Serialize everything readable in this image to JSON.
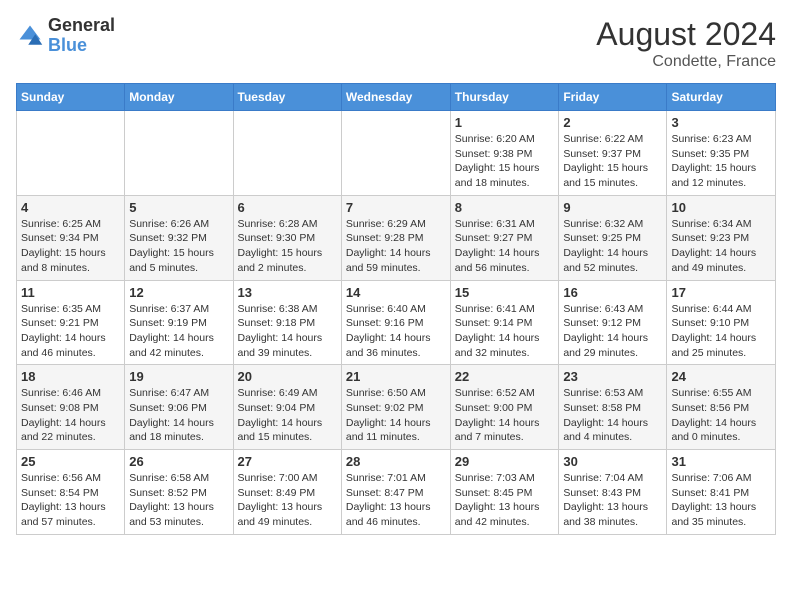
{
  "logo": {
    "general": "General",
    "blue": "Blue"
  },
  "header": {
    "month_year": "August 2024",
    "location": "Condette, France"
  },
  "weekdays": [
    "Sunday",
    "Monday",
    "Tuesday",
    "Wednesday",
    "Thursday",
    "Friday",
    "Saturday"
  ],
  "weeks": [
    [
      {
        "day": "",
        "info": ""
      },
      {
        "day": "",
        "info": ""
      },
      {
        "day": "",
        "info": ""
      },
      {
        "day": "",
        "info": ""
      },
      {
        "day": "1",
        "info": "Sunrise: 6:20 AM\nSunset: 9:38 PM\nDaylight: 15 hours and 18 minutes."
      },
      {
        "day": "2",
        "info": "Sunrise: 6:22 AM\nSunset: 9:37 PM\nDaylight: 15 hours and 15 minutes."
      },
      {
        "day": "3",
        "info": "Sunrise: 6:23 AM\nSunset: 9:35 PM\nDaylight: 15 hours and 12 minutes."
      }
    ],
    [
      {
        "day": "4",
        "info": "Sunrise: 6:25 AM\nSunset: 9:34 PM\nDaylight: 15 hours and 8 minutes."
      },
      {
        "day": "5",
        "info": "Sunrise: 6:26 AM\nSunset: 9:32 PM\nDaylight: 15 hours and 5 minutes."
      },
      {
        "day": "6",
        "info": "Sunrise: 6:28 AM\nSunset: 9:30 PM\nDaylight: 15 hours and 2 minutes."
      },
      {
        "day": "7",
        "info": "Sunrise: 6:29 AM\nSunset: 9:28 PM\nDaylight: 14 hours and 59 minutes."
      },
      {
        "day": "8",
        "info": "Sunrise: 6:31 AM\nSunset: 9:27 PM\nDaylight: 14 hours and 56 minutes."
      },
      {
        "day": "9",
        "info": "Sunrise: 6:32 AM\nSunset: 9:25 PM\nDaylight: 14 hours and 52 minutes."
      },
      {
        "day": "10",
        "info": "Sunrise: 6:34 AM\nSunset: 9:23 PM\nDaylight: 14 hours and 49 minutes."
      }
    ],
    [
      {
        "day": "11",
        "info": "Sunrise: 6:35 AM\nSunset: 9:21 PM\nDaylight: 14 hours and 46 minutes."
      },
      {
        "day": "12",
        "info": "Sunrise: 6:37 AM\nSunset: 9:19 PM\nDaylight: 14 hours and 42 minutes."
      },
      {
        "day": "13",
        "info": "Sunrise: 6:38 AM\nSunset: 9:18 PM\nDaylight: 14 hours and 39 minutes."
      },
      {
        "day": "14",
        "info": "Sunrise: 6:40 AM\nSunset: 9:16 PM\nDaylight: 14 hours and 36 minutes."
      },
      {
        "day": "15",
        "info": "Sunrise: 6:41 AM\nSunset: 9:14 PM\nDaylight: 14 hours and 32 minutes."
      },
      {
        "day": "16",
        "info": "Sunrise: 6:43 AM\nSunset: 9:12 PM\nDaylight: 14 hours and 29 minutes."
      },
      {
        "day": "17",
        "info": "Sunrise: 6:44 AM\nSunset: 9:10 PM\nDaylight: 14 hours and 25 minutes."
      }
    ],
    [
      {
        "day": "18",
        "info": "Sunrise: 6:46 AM\nSunset: 9:08 PM\nDaylight: 14 hours and 22 minutes."
      },
      {
        "day": "19",
        "info": "Sunrise: 6:47 AM\nSunset: 9:06 PM\nDaylight: 14 hours and 18 minutes."
      },
      {
        "day": "20",
        "info": "Sunrise: 6:49 AM\nSunset: 9:04 PM\nDaylight: 14 hours and 15 minutes."
      },
      {
        "day": "21",
        "info": "Sunrise: 6:50 AM\nSunset: 9:02 PM\nDaylight: 14 hours and 11 minutes."
      },
      {
        "day": "22",
        "info": "Sunrise: 6:52 AM\nSunset: 9:00 PM\nDaylight: 14 hours and 7 minutes."
      },
      {
        "day": "23",
        "info": "Sunrise: 6:53 AM\nSunset: 8:58 PM\nDaylight: 14 hours and 4 minutes."
      },
      {
        "day": "24",
        "info": "Sunrise: 6:55 AM\nSunset: 8:56 PM\nDaylight: 14 hours and 0 minutes."
      }
    ],
    [
      {
        "day": "25",
        "info": "Sunrise: 6:56 AM\nSunset: 8:54 PM\nDaylight: 13 hours and 57 minutes."
      },
      {
        "day": "26",
        "info": "Sunrise: 6:58 AM\nSunset: 8:52 PM\nDaylight: 13 hours and 53 minutes."
      },
      {
        "day": "27",
        "info": "Sunrise: 7:00 AM\nSunset: 8:49 PM\nDaylight: 13 hours and 49 minutes."
      },
      {
        "day": "28",
        "info": "Sunrise: 7:01 AM\nSunset: 8:47 PM\nDaylight: 13 hours and 46 minutes."
      },
      {
        "day": "29",
        "info": "Sunrise: 7:03 AM\nSunset: 8:45 PM\nDaylight: 13 hours and 42 minutes."
      },
      {
        "day": "30",
        "info": "Sunrise: 7:04 AM\nSunset: 8:43 PM\nDaylight: 13 hours and 38 minutes."
      },
      {
        "day": "31",
        "info": "Sunrise: 7:06 AM\nSunset: 8:41 PM\nDaylight: 13 hours and 35 minutes."
      }
    ]
  ]
}
